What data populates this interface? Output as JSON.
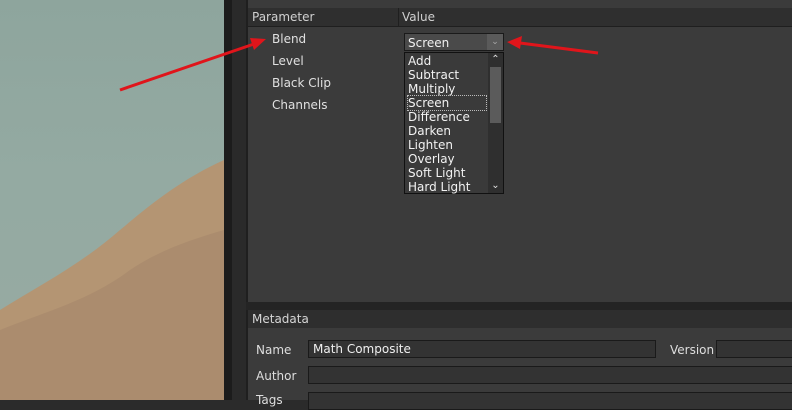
{
  "parameters": {
    "header": {
      "col_parameter": "Parameter",
      "col_value": "Value"
    },
    "rows": [
      "Blend",
      "Level",
      "Black Clip",
      "Channels"
    ],
    "blend_combo": {
      "value": "Screen"
    },
    "blend_options": [
      "Add",
      "Subtract",
      "Multiply",
      "Screen",
      "Difference",
      "Darken",
      "Lighten",
      "Overlay",
      "Soft Light",
      "Hard Light"
    ],
    "selected_option": "Screen"
  },
  "metadata": {
    "title": "Metadata",
    "name_label": "Name",
    "name_value": "Math Composite",
    "version_label": "Version",
    "version_value": "",
    "author_label": "Author",
    "author_value": "",
    "tags_label": "Tags"
  },
  "icons": {
    "float": "float-window-icon",
    "close": "close-icon",
    "combo_arrow": "chevron-down-icon",
    "scroll_up": "chevron-up-icon",
    "scroll_down": "chevron-down-icon"
  },
  "colors": {
    "annotation_arrow": "#e0151b",
    "panel_bg": "#3b3b3b",
    "field_bg": "#333333"
  }
}
